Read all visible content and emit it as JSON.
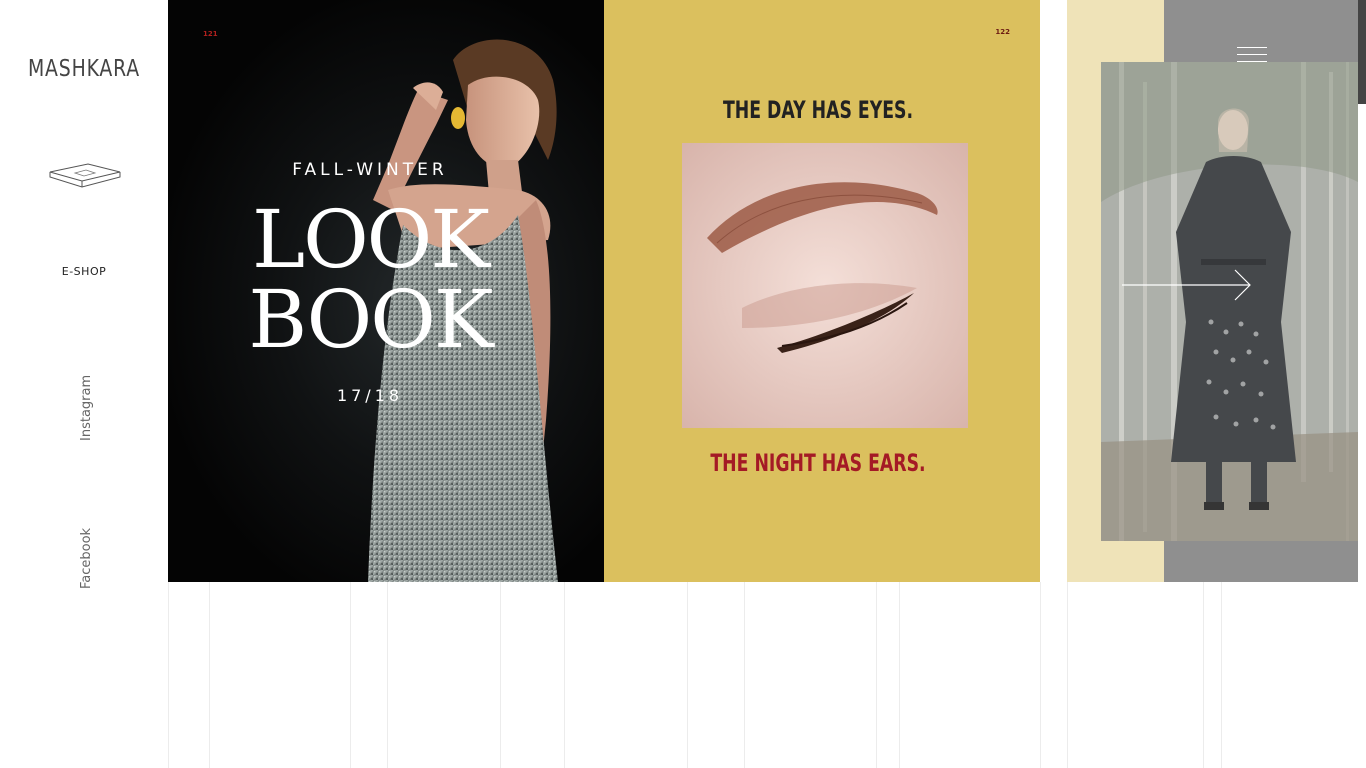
{
  "brand": {
    "name": "MASHKARA"
  },
  "nav": {
    "eshop": "E-SHOP",
    "instagram": "Instagram",
    "facebook": "Facebook"
  },
  "spread": {
    "page_left_number": "121",
    "page_right_number": "122",
    "cover": {
      "season": "FALL-WINTER",
      "title_line1": "LOOK",
      "title_line2": "BOOK",
      "years": "17/18"
    },
    "right_page": {
      "headline_top": "THE DAY HAS EYES.",
      "headline_bottom": "THE NIGHT HAS EARS."
    }
  },
  "colors": {
    "mustard": "#dbc05e",
    "crimson": "#a41a25",
    "cream": "#efe3b8",
    "gray": "#8f8f8f"
  },
  "icons": {
    "box": "box-icon",
    "menu": "hamburger-menu-icon",
    "next": "arrow-right-icon"
  }
}
